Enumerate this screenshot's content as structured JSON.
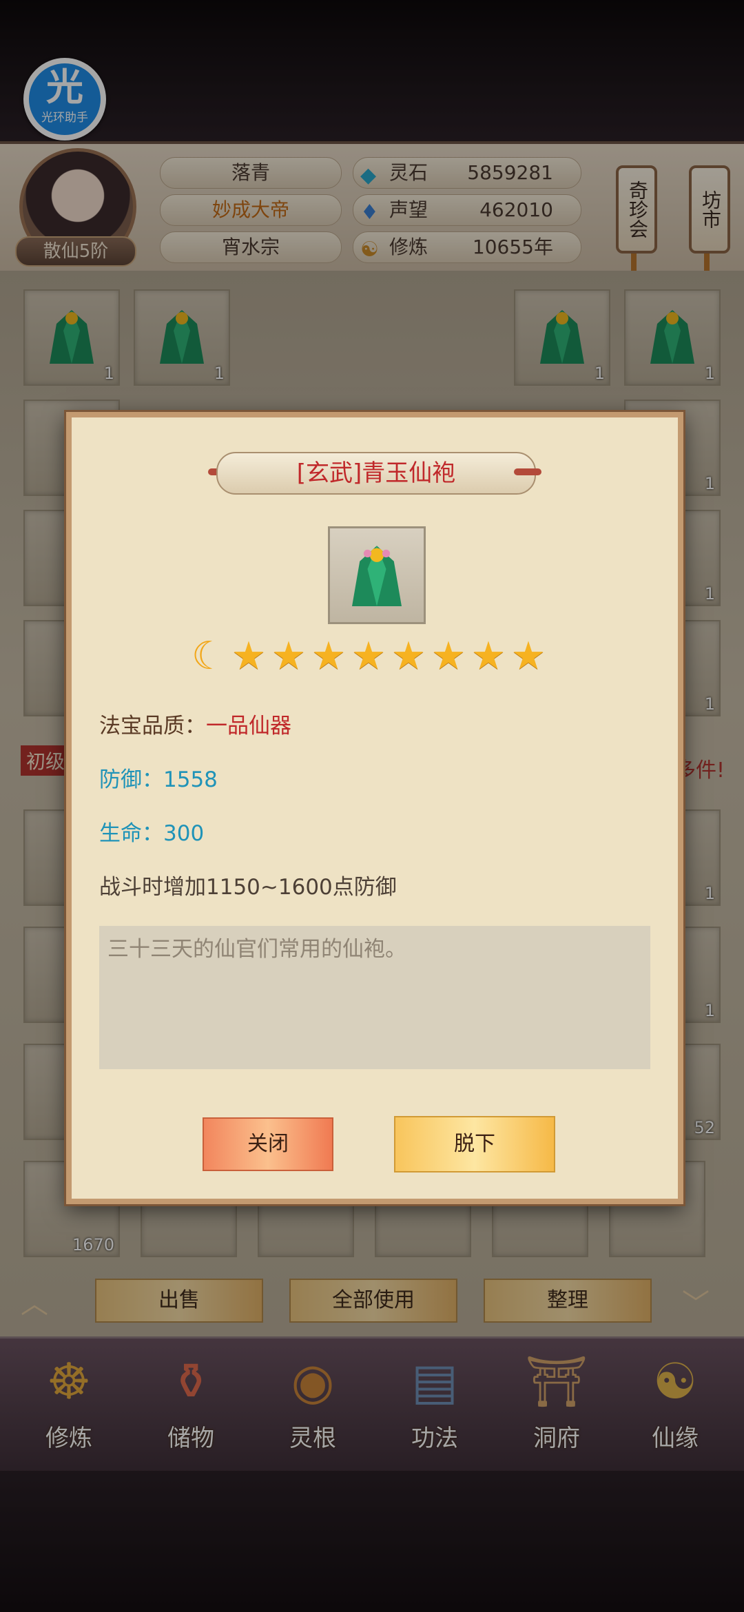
{
  "helper_badge": {
    "glyph": "光",
    "label": "光环助手"
  },
  "player": {
    "name": "落青",
    "title": "妙成大帝",
    "sect": "宵水宗",
    "rank": "散仙5阶"
  },
  "stats": [
    {
      "icon": "spirit-stone-icon",
      "label": "灵石",
      "value": "5859281"
    },
    {
      "icon": "reputation-icon",
      "label": "声望",
      "value": "462010"
    },
    {
      "icon": "cultivation-icon",
      "label": "修炼",
      "value": "10655年"
    }
  ],
  "side_buttons": {
    "treasure_fair": "奇珍会",
    "market": "坊市"
  },
  "inventory": {
    "tab_partial": "初级",
    "notice_partial": "多件!",
    "counts": {
      "c1": "1",
      "c52": "52",
      "c1670": "1670"
    }
  },
  "actions": {
    "sell": "出售",
    "use_all": "全部使用",
    "sort": "整理"
  },
  "nav": [
    {
      "label": "修炼",
      "icon": "cultivate-nav-icon"
    },
    {
      "label": "储物",
      "icon": "storage-nav-icon"
    },
    {
      "label": "灵根",
      "icon": "spirit-root-nav-icon"
    },
    {
      "label": "功法",
      "icon": "technique-nav-icon"
    },
    {
      "label": "洞府",
      "icon": "cave-nav-icon"
    },
    {
      "label": "仙缘",
      "icon": "fate-nav-icon"
    }
  ],
  "modal": {
    "title": "[玄武]青玉仙袍",
    "stars": 8,
    "quality_label": "法宝品质：",
    "quality_value": "一品仙器",
    "defense": "防御：1558",
    "life": "生命：300",
    "effect": "战斗时增加1150~1600点防御",
    "description": "三十三天的仙官们常用的仙袍。",
    "close_label": "关闭",
    "remove_label": "脱下"
  },
  "colors": {
    "quality": "#c0282a",
    "stat": "#1f93b8",
    "title": "#c0282a"
  }
}
